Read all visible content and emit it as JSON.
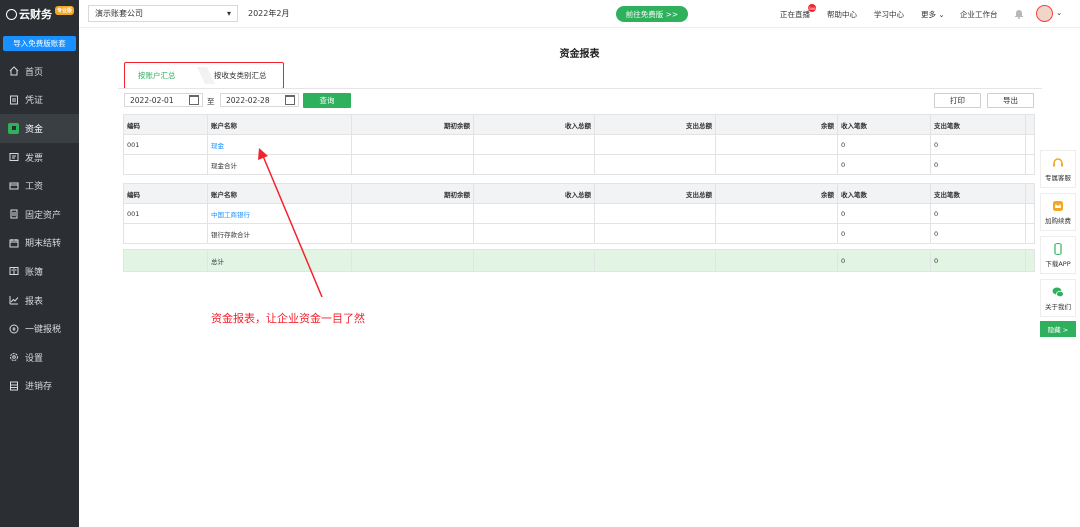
{
  "app": {
    "logo_text": "云财务",
    "logo_badge": "专业版"
  },
  "sidebar": {
    "import_button": "导入免费版账套",
    "items": [
      {
        "label": "首页",
        "icon": "home-icon"
      },
      {
        "label": "凭证",
        "icon": "document-icon"
      },
      {
        "label": "资金",
        "icon": "fund-icon"
      },
      {
        "label": "发票",
        "icon": "invoice-icon"
      },
      {
        "label": "工资",
        "icon": "card-icon"
      },
      {
        "label": "固定资产",
        "icon": "building-icon"
      },
      {
        "label": "期末结转",
        "icon": "calendar-icon"
      },
      {
        "label": "账簿",
        "icon": "book-icon"
      },
      {
        "label": "报表",
        "icon": "chart-icon"
      },
      {
        "label": "一键报税",
        "icon": "tax-icon"
      },
      {
        "label": "设置",
        "icon": "gear-icon"
      },
      {
        "label": "进销存",
        "icon": "inventory-icon"
      }
    ],
    "active_index": 2
  },
  "topbar": {
    "company": "演示账套公司",
    "period": "2022年2月",
    "free_button": "前往免费版 >>",
    "live": "正在直播",
    "live_badge": "live",
    "help": "帮助中心",
    "learn": "学习中心",
    "more": "更多",
    "workspace": "企业工作台"
  },
  "main": {
    "title": "资金报表",
    "tabs": [
      "按账户汇总",
      "按收支类别汇总"
    ],
    "date_from": "2022-02-01",
    "to_label": "至",
    "date_to": "2022-02-28",
    "query_button": "查询",
    "print_button": "打印",
    "export_button": "导出"
  },
  "table1": {
    "headers": [
      "编码",
      "账户名称",
      "期初余额",
      "收入总额",
      "支出总额",
      "余额",
      "收入笔数",
      "支出笔数"
    ],
    "rows": [
      [
        "001",
        "现金",
        "",
        "",
        "",
        "",
        "0",
        "0"
      ],
      [
        "",
        "现金合计",
        "",
        "",
        "",
        "",
        "0",
        "0"
      ]
    ]
  },
  "table2": {
    "headers": [
      "编码",
      "账户名称",
      "期初余额",
      "收入总额",
      "支出总额",
      "余额",
      "收入笔数",
      "支出笔数"
    ],
    "rows": [
      [
        "001",
        "中国工商银行",
        "",
        "",
        "",
        "",
        "0",
        "0"
      ],
      [
        "",
        "银行存款合计",
        "",
        "",
        "",
        "",
        "0",
        "0"
      ]
    ],
    "total": [
      "",
      "总计",
      "",
      "",
      "",
      "",
      "0",
      "0"
    ]
  },
  "annotation": "资金报表，让企业资金一目了然",
  "float_panel": {
    "items": [
      "专属客服",
      "加购续费",
      "下载APP",
      "关于我们"
    ],
    "hide": "隐藏 >"
  },
  "colors": {
    "sidebar_bg": "#2b2f33",
    "accent_green": "#2fb05d",
    "accent_blue": "#1890ff",
    "annotation_red": "#f5222d"
  }
}
